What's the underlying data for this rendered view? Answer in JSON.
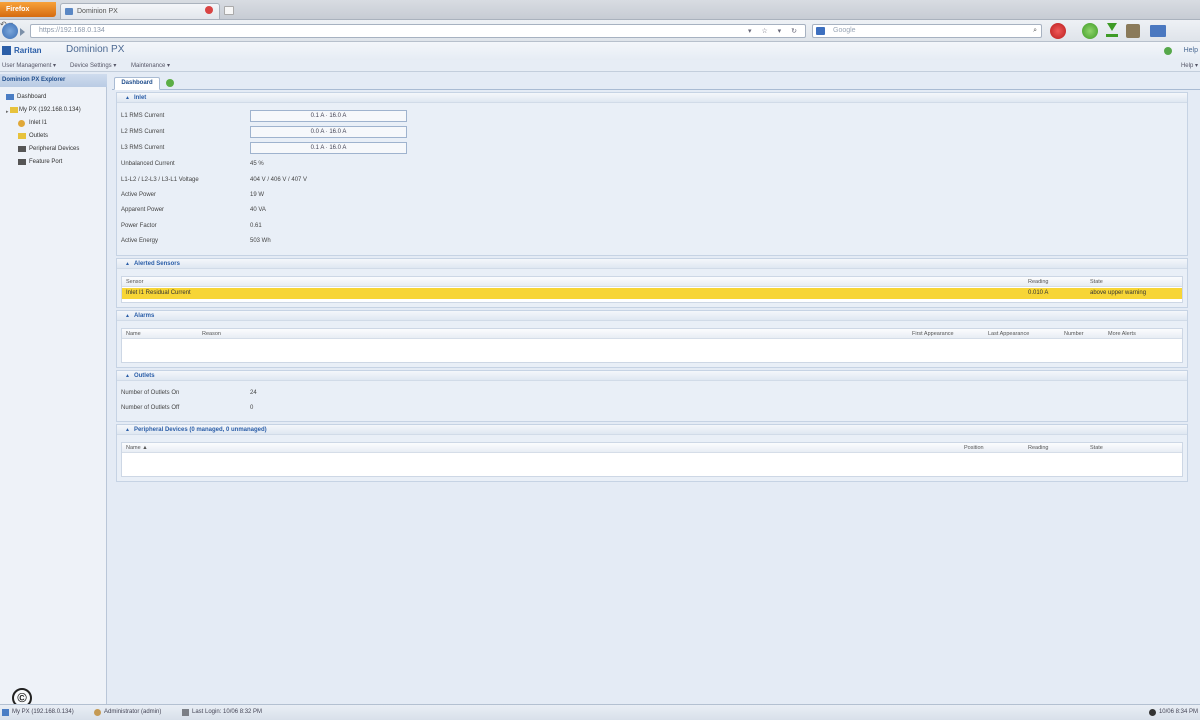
{
  "browser": {
    "app_button": "Firefox",
    "tab_title": "Dominion PX",
    "url": "https://192.168.0.134",
    "search_placeholder": "Google"
  },
  "app": {
    "logo": "Raritan",
    "title": "Dominion PX",
    "help": "Help"
  },
  "menu": {
    "user_management": "User Management ▾",
    "device_settings": "Device Settings ▾",
    "maintenance": "Maintenance ▾",
    "help": "Help ▾"
  },
  "sidebar": {
    "title": "Dominion PX Explorer",
    "items": [
      {
        "label": "Dashboard"
      },
      {
        "label": "My PX (192.168.0.134)"
      },
      {
        "label": "Inlet I1"
      },
      {
        "label": "Outlets"
      },
      {
        "label": "Peripheral Devices"
      },
      {
        "label": "Feature Port"
      }
    ]
  },
  "tabs": {
    "dashboard": "Dashboard"
  },
  "inlet": {
    "title": "Inlet",
    "rows": [
      {
        "label": "L1 RMS Current",
        "meter": "0.1 A · 16.0 A"
      },
      {
        "label": "L2 RMS Current",
        "meter": "0.0 A · 16.0 A"
      },
      {
        "label": "L3 RMS Current",
        "meter": "0.1 A · 16.0 A"
      }
    ],
    "kv": [
      {
        "label": "Unbalanced Current",
        "value": "45 %"
      },
      {
        "label": "L1-L2 / L2-L3 / L3-L1 Voltage",
        "value": "404 V / 406 V / 407 V"
      },
      {
        "label": "Active Power",
        "value": "19 W"
      },
      {
        "label": "Apparent Power",
        "value": "40 VA"
      },
      {
        "label": "Power Factor",
        "value": "0.61"
      },
      {
        "label": "Active Energy",
        "value": "503 Wh"
      }
    ]
  },
  "sensors": {
    "title": "Alerted Sensors",
    "columns": [
      "Sensor",
      "Reading",
      "State"
    ],
    "rows": [
      {
        "sensor": "Inlet I1 Residual Current",
        "reading": "0.010 A",
        "state": "above upper warning"
      }
    ]
  },
  "alarms": {
    "title": "Alarms",
    "columns": [
      "Name",
      "Reason",
      "First Appearance",
      "Last Appearance",
      "Number",
      "More Alerts"
    ]
  },
  "outlets": {
    "title": "Outlets",
    "kv": [
      {
        "label": "Number of Outlets On",
        "value": "24"
      },
      {
        "label": "Number of Outlets Off",
        "value": "0"
      }
    ]
  },
  "peripheral": {
    "title": "Peripheral Devices (0 managed, 0 unmanaged)",
    "columns": [
      "Name ▲",
      "Position",
      "Reading",
      "State"
    ]
  },
  "statusbar": {
    "pdu": "My PX (192.168.0.134)",
    "user": "Administrator (admin)",
    "last_login": "Last Login: 10/06 8:32 PM",
    "time": "10/06 8:34 PM"
  },
  "copyright": "©"
}
